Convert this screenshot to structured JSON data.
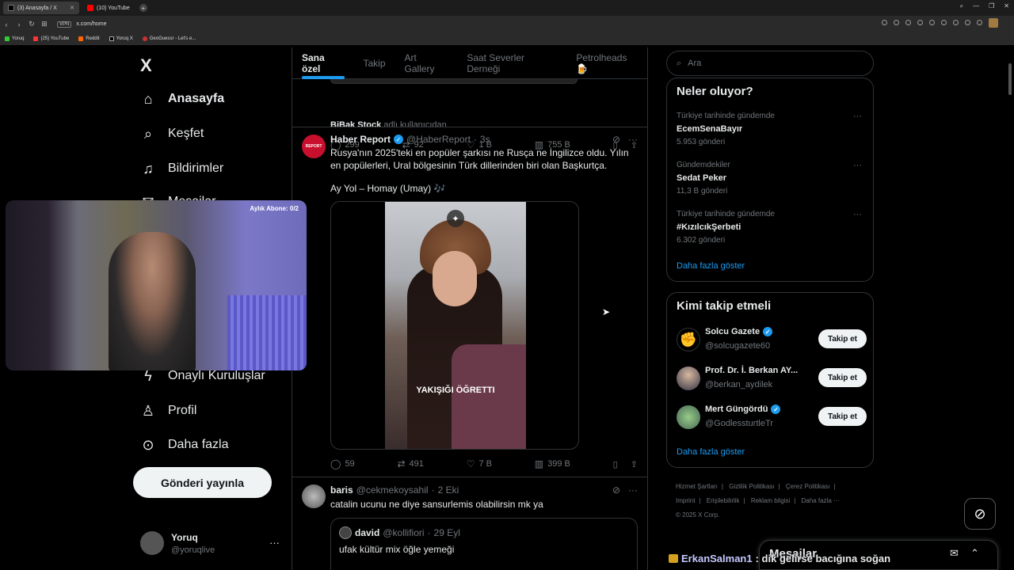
{
  "browser": {
    "tabs": [
      {
        "label": "(3) Anasayfa / X",
        "active": true
      },
      {
        "label": "(10) YouTube",
        "active": false
      }
    ],
    "url": "x.com/home",
    "vpn": "VPN",
    "bookmarks": [
      "Yoruq",
      "(25) YouTube",
      "Reddit",
      "Yoruq X",
      "GeoGuessr - Let's e..."
    ],
    "window_controls": [
      "search-icon",
      "minimize-icon",
      "restore-icon",
      "close-icon"
    ]
  },
  "sidebar": {
    "logo": "X",
    "items": [
      {
        "label": "Anasayfa",
        "icon": "home-icon",
        "active": true
      },
      {
        "label": "Keşfet",
        "icon": "search-icon"
      },
      {
        "label": "Bildirimler",
        "icon": "bell-icon"
      },
      {
        "label": "Mesajlar",
        "icon": "mail-icon"
      },
      {
        "label": "Onaylı Kuruluşlar",
        "icon": "lightning-icon"
      },
      {
        "label": "Profil",
        "icon": "person-icon"
      },
      {
        "label": "Daha fazla",
        "icon": "more-circle-icon"
      }
    ],
    "post_button": "Gönderi yayınla",
    "account": {
      "name": "Yoruq",
      "handle": "@yoruqlive"
    }
  },
  "webcam": {
    "label": "Aylık Abone: 0/2"
  },
  "timeline": {
    "tabs": [
      "Sana özel",
      "Takip",
      "Art Gallery",
      "Saat Severler Derneği",
      "Petrolheads 🍺"
    ],
    "previous_post": {
      "source_name": "BiBak Stock",
      "source_suffix": "adlı kullanıcıdan",
      "replies": "299",
      "reposts": "92",
      "likes": "1 B",
      "views": "755 B"
    },
    "posts": [
      {
        "name": "Haber Report",
        "verified": true,
        "handle": "@HaberReport",
        "time": "3s",
        "avatar_text": "REPORT",
        "text": "Rusya'nın 2025'teki en popüler şarkısı ne Rusça ne İngilizce oldu. Yılın en popülerleri, Ural bölgesinin Türk dillerinden biri olan Başkurtça.",
        "text2": "Ay Yol – Homay (Umay) 🎶",
        "media_caption": "YAKIŞIĞI ÖĞRETTI",
        "replies": "59",
        "reposts": "491",
        "likes": "7 B",
        "views": "399 B"
      },
      {
        "name": "baris",
        "handle": "@cekmekoysahil",
        "time": "2 Eki",
        "text": "catalin ucunu ne diye sansurlemis olabilirsin mk ya",
        "quote": {
          "name": "david",
          "handle": "@kollifiori",
          "time": "29 Eyl",
          "text": "ufak kültür mix öğle yemeği"
        }
      }
    ]
  },
  "right": {
    "search_placeholder": "Ara",
    "trends_title": "Neler oluyor?",
    "trends": [
      {
        "context": "Türkiye tarihinde gündemde",
        "name": "EcemSenaBayır",
        "count": "5.953 gönderi"
      },
      {
        "context": "Gündemdekiler",
        "name": "Sedat Peker",
        "count": "11,3 B gönderi"
      },
      {
        "context": "Türkiye tarihinde gündemde",
        "name": "#KızılcıkŞerbeti",
        "count": "6.302 gönderi"
      }
    ],
    "show_more": "Daha fazla göster",
    "who_title": "Kimi takip etmeli",
    "who": [
      {
        "name": "Solcu Gazete",
        "handle": "@solcugazete60",
        "verified": true
      },
      {
        "name": "Prof. Dr. İ. Berkan AY...",
        "handle": "@berkan_aydilek",
        "verified": false
      },
      {
        "name": "Mert Güngördü",
        "handle": "@GodlessturtleTr",
        "verified": true
      }
    ],
    "follow_label": "Takip et",
    "footer": [
      "Hizmet Şartları",
      "Gizlilik Politikası",
      "Çerez Politikası",
      "Imprint",
      "Erişilebilirlik",
      "Reklam bilgisi",
      "Daha fazla ···",
      "© 2025 X Corp."
    ]
  },
  "messages": {
    "title": "Mesajlar"
  },
  "chat_overlay": {
    "user": "ErkanSalman1",
    "text": ": dik gelirse bacığına soğan"
  },
  "colors": {
    "accent": "#1d9bf0",
    "background": "#000000",
    "muted": "#71767b",
    "text": "#e7e9ea"
  }
}
